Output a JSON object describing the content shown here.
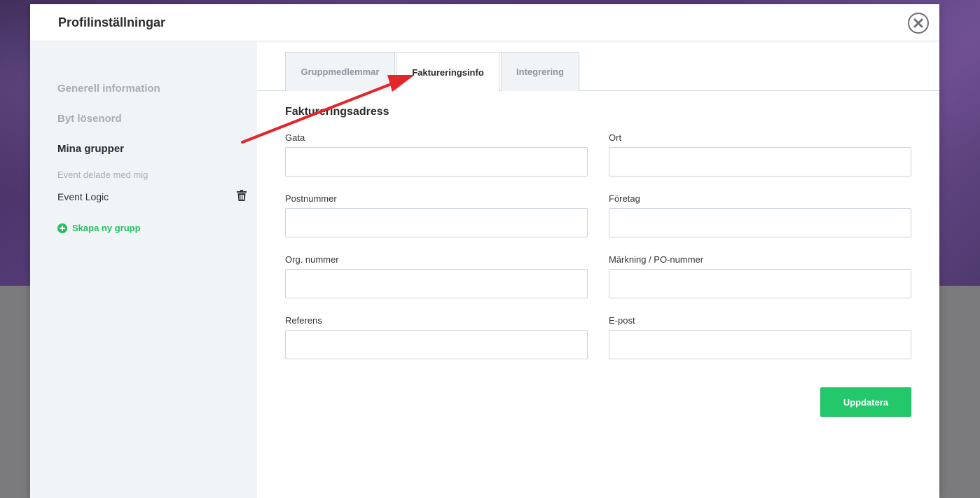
{
  "modal": {
    "title": "Profilinställningar"
  },
  "sidebar": {
    "items": [
      {
        "label": "Generell information"
      },
      {
        "label": "Byt lösenord"
      },
      {
        "label": "Mina grupper"
      }
    ],
    "shared_heading": "Event delade med mig",
    "group_name": "Event Logic",
    "create_label": "Skapa ny grupp"
  },
  "tabs": [
    {
      "label": "Gruppmedlemmar"
    },
    {
      "label": "Faktureringsinfo"
    },
    {
      "label": "Integrering"
    }
  ],
  "form": {
    "section_title": "Faktureringsadress",
    "fields": [
      {
        "label": "Gata",
        "value": "",
        "placeholder": ""
      },
      {
        "label": "Ort",
        "value": "",
        "placeholder": ""
      },
      {
        "label": "Postnummer",
        "value": "",
        "placeholder": ""
      },
      {
        "label": "Företag",
        "value": "",
        "placeholder": ""
      },
      {
        "label": "Org. nummer",
        "value": "",
        "placeholder": ""
      },
      {
        "label": "Märkning / PO-nummer",
        "value": "",
        "placeholder": ""
      },
      {
        "label": "Referens",
        "value": "",
        "placeholder": ""
      },
      {
        "label": "E-post",
        "value": "",
        "placeholder": ""
      }
    ],
    "submit_label": "Uppdatera"
  },
  "colors": {
    "accent_green": "#23c86a",
    "annotation_arrow": "#e3262b",
    "sidebar_bg": "#f1f4f7"
  },
  "icons": [
    "close-icon",
    "trash-icon",
    "plus-circle-icon"
  ]
}
